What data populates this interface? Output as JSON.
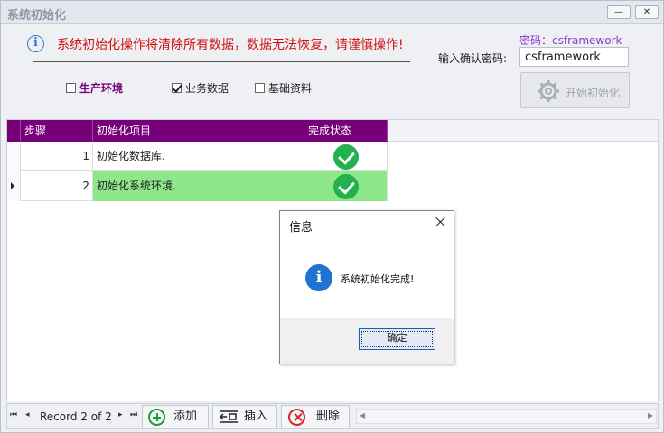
{
  "window": {
    "title": "系统初始化",
    "minimize_glyph": "—",
    "close_glyph": "✕"
  },
  "header": {
    "warning_text": "系统初始化操作将清除所有数据，数据无法恢复，请谨慎操作!",
    "password_hint": "密码：csframework",
    "password_label": "输入确认密码:",
    "password_value": "csframework",
    "init_button_label": "开始初始化"
  },
  "checkboxes": [
    {
      "label": "生产环境",
      "checked": false
    },
    {
      "label": "业务数据",
      "checked": true
    },
    {
      "label": "基础资料",
      "checked": false
    }
  ],
  "grid": {
    "columns": [
      "步骤",
      "初始化项目",
      "完成状态"
    ],
    "rows": [
      {
        "step": "1",
        "item": "初始化数据库.",
        "status": "done",
        "current": false
      },
      {
        "step": "2",
        "item": "初始化系统环境.",
        "status": "done",
        "current": true
      }
    ]
  },
  "footer": {
    "record_text": "Record 2 of 2",
    "add_label": "添加",
    "insert_label": "插入",
    "delete_label": "删除",
    "nav_first": "⏮",
    "nav_prev": "◂",
    "nav_next": "▸",
    "nav_last": "⏭"
  },
  "dialog": {
    "title": "信息",
    "message": "系统初始化完成!",
    "ok_label": "确定",
    "icon_glyph": "i"
  },
  "colors": {
    "grid_header": "#77007a",
    "current_row": "#8ee78a",
    "warning": "#d01010",
    "status_ok": "#23b04e",
    "hint": "#8e36c7"
  },
  "icons": {
    "info": "info-icon",
    "status": "check-circle-icon",
    "init": "gear-icon",
    "add": "plus-circle-icon",
    "insert": "insert-row-icon",
    "delete": "delete-circle-icon"
  }
}
